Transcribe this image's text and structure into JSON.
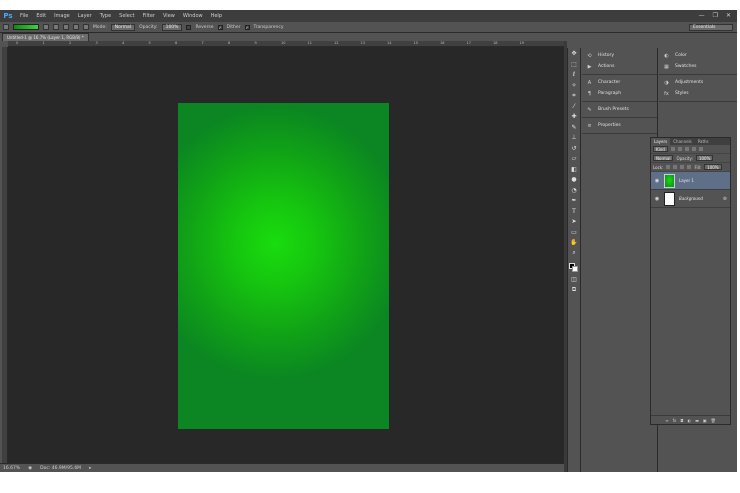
{
  "app": {
    "logo": "Ps"
  },
  "menu": [
    "File",
    "Edit",
    "Image",
    "Layer",
    "Type",
    "Select",
    "Filter",
    "View",
    "Window",
    "Help"
  ],
  "window_controls": {
    "minimize": "—",
    "restore": "❐",
    "close": "✕"
  },
  "options": {
    "mode_label": "Mode:",
    "mode_value": "Normal",
    "opacity_label": "Opacity:",
    "opacity_value": "100%",
    "reverse_label": "Reverse",
    "dither_label": "Dither",
    "transparency_label": "Transparency",
    "workspace": "Essentials"
  },
  "document": {
    "tab_title": "Untitled-1 @ 16.7% (Layer 1, RGB/8) *",
    "ruler_ticks": [
      "0",
      "1",
      "2",
      "3",
      "4",
      "5",
      "6",
      "7",
      "8",
      "9",
      "10",
      "11",
      "12",
      "13",
      "14",
      "15",
      "16",
      "17",
      "18",
      "19"
    ]
  },
  "status": {
    "zoom": "16.67%",
    "doc_size": "Doc: 46.9M/95.6M"
  },
  "dock_left": [
    {
      "icon": "history-icon",
      "glyph": "⟲",
      "label": "History"
    },
    {
      "icon": "actions-icon",
      "glyph": "▶",
      "label": "Actions"
    },
    {
      "icon": "character-icon",
      "glyph": "A",
      "label": "Character"
    },
    {
      "icon": "paragraph-icon",
      "glyph": "¶",
      "label": "Paragraph"
    },
    {
      "icon": "brush-presets-icon",
      "glyph": "✎",
      "label": "Brush Presets"
    },
    {
      "icon": "properties-icon",
      "glyph": "≡",
      "label": "Properties"
    }
  ],
  "dock_right": [
    {
      "icon": "color-icon",
      "glyph": "◐",
      "label": "Color"
    },
    {
      "icon": "swatches-icon",
      "glyph": "▦",
      "label": "Swatches"
    },
    {
      "icon": "adjustments-icon",
      "glyph": "◑",
      "label": "Adjustments"
    },
    {
      "icon": "styles-icon",
      "glyph": "fx",
      "label": "Styles"
    }
  ],
  "layers_panel": {
    "tabs": [
      "Layers",
      "Channels",
      "Paths"
    ],
    "kind_label": "Kind",
    "blend_mode": "Normal",
    "opacity_label": "Opacity:",
    "opacity_value": "100%",
    "lock_label": "Lock:",
    "fill_label": "Fill:",
    "fill_value": "100%",
    "layers": [
      {
        "name": "Layer 1",
        "selected": true
      },
      {
        "name": "Background",
        "selected": false
      }
    ]
  },
  "colors": {
    "foreground": "#000000",
    "background": "#ffffff",
    "gradient_center": "#19dc0e",
    "gradient_edge": "#0b8622"
  }
}
